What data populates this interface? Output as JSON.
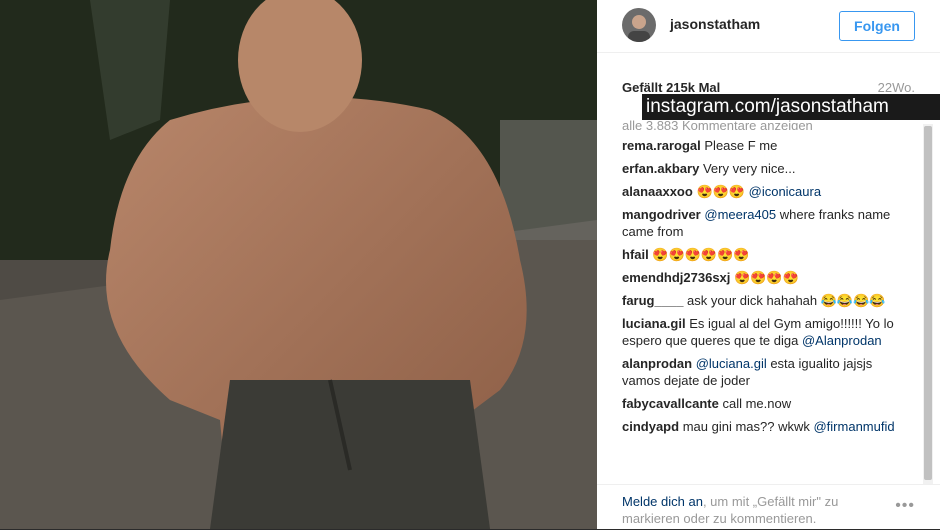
{
  "post": {
    "username": "jasonstatham",
    "follow_label": "Folgen",
    "likes": "Gefällt 215k Mal",
    "age": "22Wo.",
    "all_comments": "alle 3.883 Kommentare anzeigen"
  },
  "overlay_text": "instagram.com/jasonstatham",
  "comments": [
    {
      "user": "rema.rarogal",
      "text": "Please F me"
    },
    {
      "user": "erfan.akbary",
      "text": "Very very nice..."
    },
    {
      "user": "alanaaxxoo",
      "text": "😍😍😍 ",
      "mention": "@iconicaura"
    },
    {
      "user": "mangodriver",
      "mention": "@meera405",
      "text": " where franks name came from"
    },
    {
      "user": "hfail",
      "text": "😍😍😍😍😍😍"
    },
    {
      "user": "emendhdj2736sxj",
      "text": "😍😍😍😍"
    },
    {
      "user": "farug____",
      "text": "ask your dick hahahah 😂😂😂😂"
    },
    {
      "user": "luciana.gil",
      "text": "Es igual al del Gym amigo!!!!!! Yo lo espero que queres que te diga ",
      "mention": "@Alanprodan"
    },
    {
      "user": "alanprodan",
      "mention": "@luciana.gil",
      "text": " esta igualito jajsjs vamos dejate de joder"
    },
    {
      "user": "fabycavallcante",
      "text": "call me.now"
    },
    {
      "user": "cindyapd",
      "text": "mau gini mas?? wkwk ",
      "mention": "@firmanmufid"
    }
  ],
  "footer": {
    "login_link": "Melde dich an",
    "login_text": ", um mit „Gefällt mir\" zu markieren oder zu kommentieren.",
    "more_icon": "more-icon"
  }
}
